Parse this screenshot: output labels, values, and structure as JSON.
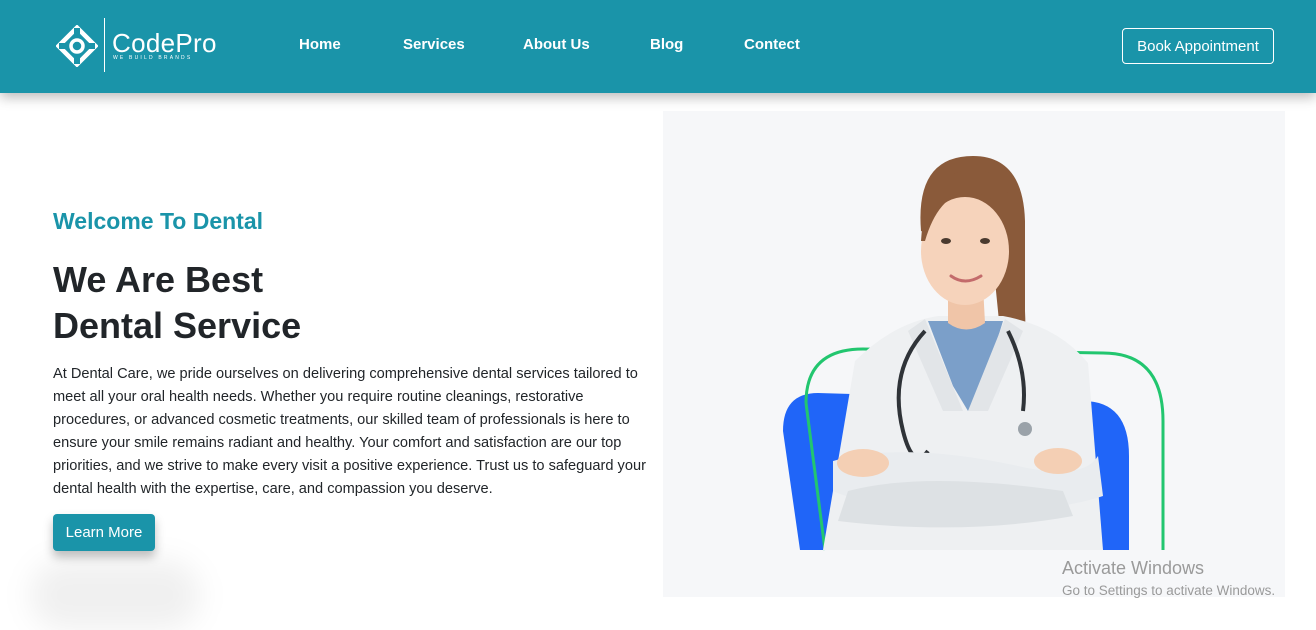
{
  "brand": {
    "name": "CodePro",
    "tagline": "WE BUILD BRANDS",
    "logo_icon": "diamond-ring-logo-icon"
  },
  "nav": {
    "links": [
      {
        "label": "Home"
      },
      {
        "label": "Services"
      },
      {
        "label": "About Us"
      },
      {
        "label": "Blog"
      },
      {
        "label": "Contect"
      }
    ],
    "cta_label": "Book Appointment"
  },
  "hero": {
    "eyebrow": "Welcome To Dental",
    "headline_line1": "We Are Best",
    "headline_line2": "Dental Service",
    "body": "At Dental Care, we pride ourselves on delivering comprehensive dental services tailored to meet all your oral health needs. Whether you require routine cleanings, restorative procedures, or advanced cosmetic treatments, our skilled team of professionals is here to ensure your smile remains radiant and healthy. Your comfort and satisfaction are our top priorities, and we strive to make every visit a positive experience. Trust us to safeguard your dental health with the expertise, care, and compassion you deserve.",
    "button_label": "Learn More",
    "image": "doctor-portrait"
  },
  "watermark": {
    "title": "Activate Windows",
    "subtitle": "Go to Settings to activate Windows."
  },
  "colors": {
    "primary": "#1a94a9",
    "text": "#212529",
    "accent_blue": "#2065f8",
    "accent_green": "#22c66f",
    "image_bg": "#f6f7f9"
  }
}
